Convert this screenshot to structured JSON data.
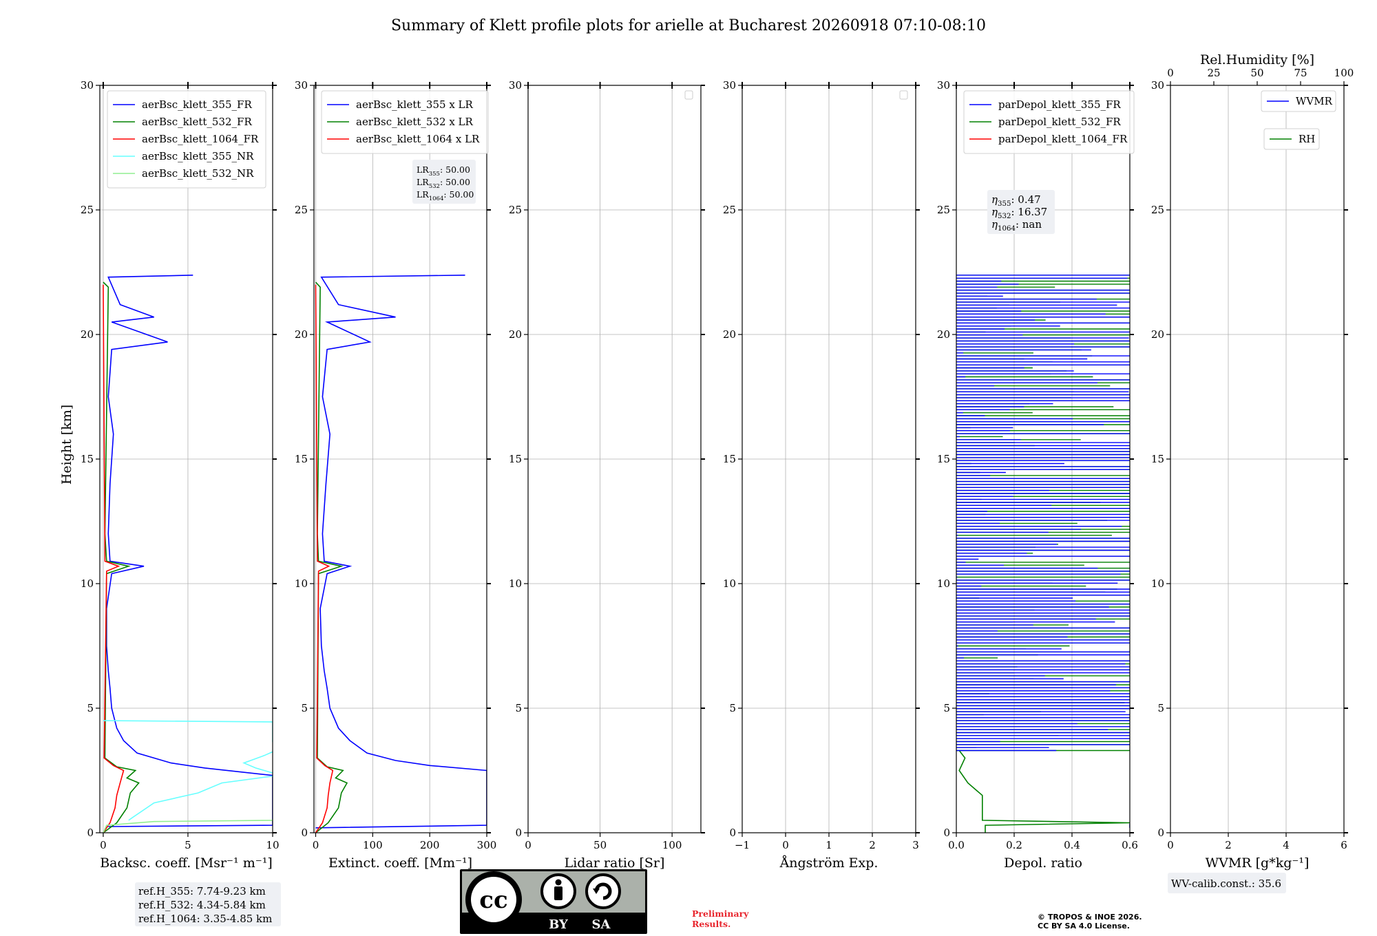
{
  "title": "Summary of Klett profile plots for arielle at Bucharest 20260918 07:10-08:10",
  "y_label": "Height [km]",
  "y_ticks": [
    "0",
    "5",
    "10",
    "15",
    "20",
    "25",
    "30"
  ],
  "panels": [
    {
      "id": "backscatter",
      "xlabel": "Backsc. coeff. [Msr⁻¹ m⁻¹]",
      "xlim": [
        -0.2,
        10
      ],
      "xticks": [
        0,
        5,
        10
      ],
      "xtick_labels": [
        "0",
        "5",
        "10"
      ],
      "legend": [
        "aerBsc_klett_355_FR",
        "aerBsc_klett_532_FR",
        "aerBsc_klett_1064_FR",
        "aerBsc_klett_355_NR",
        "aerBsc_klett_532_NR"
      ],
      "legend_colors": [
        "#0000ff",
        "#008000",
        "#ff0000",
        "#66ffff",
        "#90ee90"
      ],
      "info_box": [
        "ref.H_355: 7.74-9.23 km",
        "ref.H_532: 4.34-5.84 km",
        "ref.H_1064: 3.35-4.85 km"
      ]
    },
    {
      "id": "extinction",
      "xlabel": "Extinct. coeff. [Mm⁻¹]",
      "xlim": [
        -3,
        300
      ],
      "xticks": [
        0,
        100,
        200,
        300
      ],
      "xtick_labels": [
        "0",
        "100",
        "200",
        "300"
      ],
      "legend": [
        "aerBsc_klett_355 x LR",
        "aerBsc_klett_532 x LR",
        "aerBsc_klett_1064 x LR"
      ],
      "legend_colors": [
        "#0000ff",
        "#008000",
        "#ff0000"
      ],
      "lr_box": [
        {
          "sub": "355",
          "value": ": 50.00"
        },
        {
          "sub": "532",
          "value": ": 50.00"
        },
        {
          "sub": "1064",
          "value": ": 50.00"
        }
      ]
    },
    {
      "id": "lidar-ratio",
      "xlabel": "Lidar ratio [Sr]",
      "xlim": [
        0,
        120
      ],
      "xticks": [
        0,
        50,
        100
      ],
      "xtick_labels": [
        "0",
        "50",
        "100"
      ]
    },
    {
      "id": "angstrom",
      "xlabel": "Ångström Exp.",
      "xlim": [
        -1,
        3
      ],
      "xticks": [
        -1,
        0,
        1,
        2,
        3
      ],
      "xtick_labels": [
        "−1",
        "0",
        "1",
        "2",
        "3"
      ]
    },
    {
      "id": "depol",
      "xlabel": "Depol. ratio",
      "xlim": [
        0,
        0.6
      ],
      "xticks": [
        0,
        0.2,
        0.4,
        0.6
      ],
      "xtick_labels": [
        "0.0",
        "0.2",
        "0.4",
        "0.6"
      ],
      "legend": [
        "parDepol_klett_355_FR",
        "parDepol_klett_532_FR",
        "parDepol_klett_1064_FR"
      ],
      "legend_colors": [
        "#0000ff",
        "#008000",
        "#ff0000"
      ],
      "eta_box": [
        {
          "sub": "355",
          "value": ": 0.47"
        },
        {
          "sub": "532",
          "value": ": 16.37"
        },
        {
          "sub": "1064",
          "value": ": nan"
        }
      ]
    },
    {
      "id": "wvmr",
      "xlabel": "WVMR [g*kg⁻¹]",
      "xlim": [
        0,
        6
      ],
      "xticks": [
        0,
        2,
        4,
        6
      ],
      "xtick_labels": [
        "0",
        "2",
        "4",
        "6"
      ],
      "top_label": "Rel.Humidity [%]",
      "top_xlim": [
        0,
        100
      ],
      "top_ticks": [
        0,
        25,
        50,
        75,
        100
      ],
      "top_tick_labels": [
        "0",
        "25",
        "50",
        "75",
        "100"
      ],
      "legend_wvmr": "WVMR",
      "legend_rh": "RH",
      "info_box": [
        "WV-calib.const.: 35.6"
      ]
    }
  ],
  "chart_data": [
    {
      "type": "line",
      "panel": "backscatter",
      "ylim": [
        0,
        30
      ],
      "series": [
        {
          "name": "aerBsc_klett_355_FR",
          "color": "#0000ff",
          "y": [
            0.25,
            0.3,
            2.3,
            2.6,
            2.8,
            3.2,
            3.7,
            4.2,
            5.0,
            5.8,
            6.5,
            7.5,
            9.0,
            10.4,
            10.7,
            10.9,
            12,
            14,
            16,
            17.5,
            19.4,
            19.7,
            20.5,
            20.7,
            21.2,
            22.3,
            22.38
          ],
          "x": [
            0.3,
            10,
            10,
            6,
            4,
            2,
            1.2,
            0.8,
            0.5,
            0.4,
            0.3,
            0.2,
            0.2,
            0.5,
            2.4,
            0.4,
            0.3,
            0.4,
            0.6,
            0.3,
            0.5,
            3.8,
            0.5,
            3.0,
            1.0,
            0.3,
            5.3
          ]
        },
        {
          "name": "aerBsc_klett_532_FR",
          "color": "#008000",
          "y": [
            0.0,
            0.4,
            1.0,
            1.6,
            2.0,
            2.2,
            2.5,
            2.65,
            3.0,
            10.4,
            10.7,
            10.9,
            12,
            21.9,
            22.1
          ],
          "x": [
            0.0,
            0.8,
            1.4,
            1.6,
            2.1,
            1.4,
            1.9,
            0.8,
            0.1,
            0.2,
            1.5,
            0.2,
            0.1,
            0.3,
            0.0
          ]
        },
        {
          "name": "aerBsc_klett_1064_FR",
          "color": "#ff0000",
          "y": [
            0.0,
            0.4,
            1.0,
            1.5,
            2.0,
            2.5,
            2.7,
            3.0,
            10.5,
            10.7,
            10.9,
            22.0
          ],
          "x": [
            0.0,
            0.4,
            0.7,
            0.8,
            1.0,
            1.2,
            0.6,
            0.05,
            0.2,
            0.9,
            0.1,
            0.0
          ]
        },
        {
          "name": "aerBsc_klett_355_NR",
          "color": "#66ffff",
          "y": [
            0.5,
            0.6,
            1.2,
            1.6,
            2.0,
            2.3,
            2.4,
            2.6,
            2.8,
            3.1,
            3.4,
            3.65,
            4.45,
            4.5
          ],
          "x": [
            1.5,
            1.7,
            3.0,
            5.6,
            7.0,
            10.3,
            10.0,
            9.0,
            8.3,
            9.5,
            10.5,
            10,
            10,
            0.0
          ]
        },
        {
          "name": "aerBsc_klett_532_NR",
          "color": "#90ee90",
          "y": [
            0.0,
            0.3,
            0.45,
            0.5,
            0.55
          ],
          "x": [
            0.0,
            0.2,
            3.0,
            10,
            10
          ]
        }
      ]
    },
    {
      "type": "line",
      "panel": "extinction",
      "ylim": [
        0,
        30
      ],
      "series": [
        {
          "name": "aerBsc_klett_355 x LR",
          "color": "#0000ff",
          "y": [
            0.2,
            0.3,
            2.5,
            2.7,
            2.9,
            3.2,
            3.7,
            4.2,
            5.0,
            5.8,
            6.5,
            7.5,
            9.0,
            10.4,
            10.7,
            10.9,
            12,
            14,
            16,
            17.5,
            19.4,
            19.7,
            20.5,
            20.7,
            21.2,
            22.3,
            22.38
          ],
          "x": [
            0,
            300,
            300,
            200,
            140,
            90,
            60,
            40,
            25,
            20,
            15,
            10,
            8,
            20,
            60,
            15,
            12,
            18,
            25,
            12,
            20,
            95,
            20,
            140,
            40,
            10,
            262
          ]
        },
        {
          "name": "aerBsc_klett_532 x LR",
          "color": "#008000",
          "y": [
            0.0,
            0.4,
            1.0,
            1.6,
            2.0,
            2.2,
            2.5,
            2.65,
            3.0,
            10.4,
            10.7,
            10.9,
            12,
            21.9,
            22.1
          ],
          "x": [
            0,
            22,
            40,
            45,
            55,
            35,
            48,
            20,
            3,
            5,
            45,
            5,
            3,
            8,
            0
          ]
        },
        {
          "name": "aerBsc_klett_1064 x LR",
          "color": "#ff0000",
          "y": [
            0.0,
            0.4,
            1.0,
            1.5,
            2.0,
            2.5,
            2.7,
            3.0,
            10.5,
            10.7,
            10.9,
            22.0
          ],
          "x": [
            0,
            12,
            20,
            22,
            25,
            30,
            16,
            2,
            5,
            23,
            3,
            0
          ]
        }
      ]
    },
    {
      "type": "line",
      "panel": "depol",
      "ylim": [
        0,
        30
      ],
      "xlim": [
        0,
        0.6
      ],
      "series": [
        {
          "name": "parDepol_klett_532_FR",
          "color": "#008000",
          "y": [
            0.0,
            0.3,
            0.4,
            0.5,
            1.0,
            1.5,
            1.7,
            2.0,
            2.5,
            3.0,
            3.3
          ],
          "x": [
            0.1,
            0.1,
            0.6,
            0.09,
            0.09,
            0.09,
            0.07,
            0.04,
            0.01,
            0.03,
            0.01
          ],
          "note_y_noise_range": [
            3.3,
            22.4
          ]
        },
        {
          "name": "parDepol_klett_355_FR",
          "color": "#0000ff",
          "y": [
            0.2,
            0.35
          ],
          "x": [
            0.6,
            0.6
          ],
          "note_y_noise_range": [
            3.3,
            22.4
          ]
        }
      ]
    }
  ]
}
